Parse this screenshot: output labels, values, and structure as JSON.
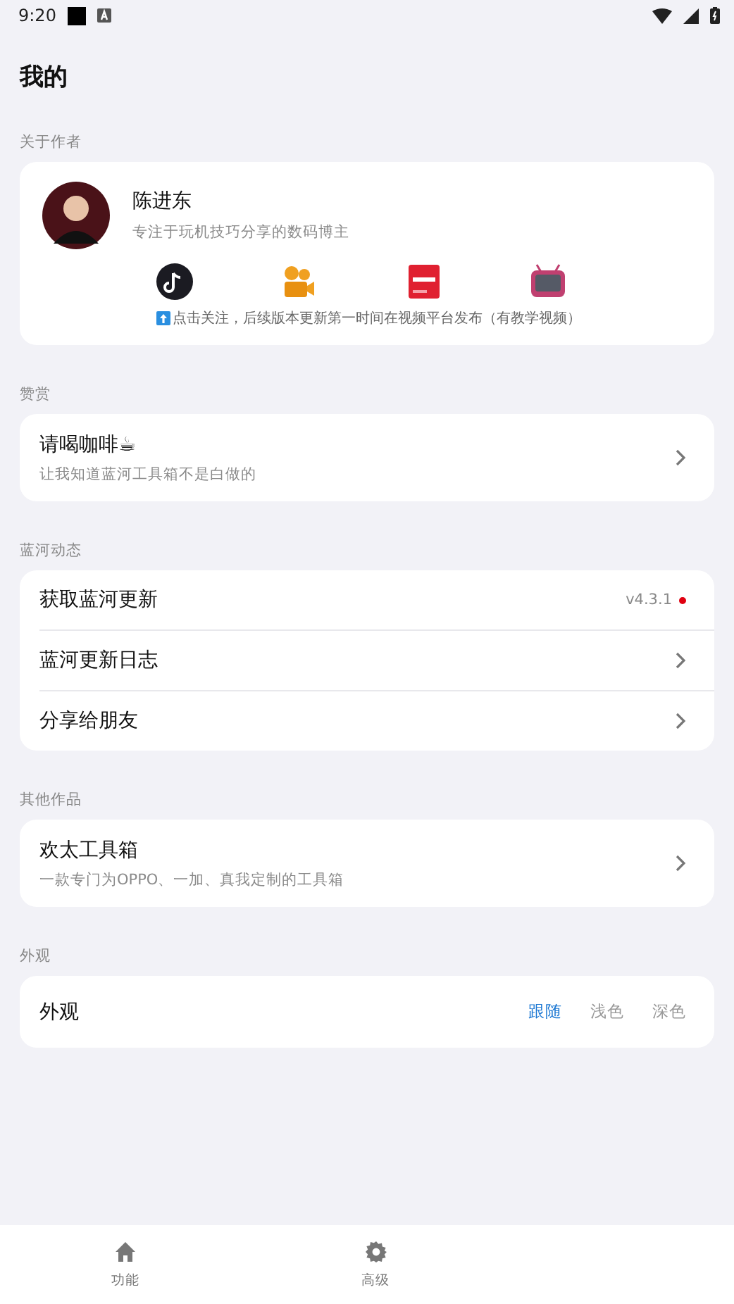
{
  "status_bar": {
    "time": "9:20"
  },
  "title": "我的",
  "author_section": {
    "header": "关于作者",
    "name": "陈进东",
    "bio": "专注于玩机技巧分享的数码博主",
    "platforms": [
      {
        "kind": "note"
      },
      {
        "kind": "camera"
      },
      {
        "kind": "book"
      },
      {
        "kind": "tv"
      }
    ],
    "hint": "点击关注，后续版本更新第一时间在视频平台发布（有教学视频）"
  },
  "sections": [
    {
      "header": "赞赏",
      "rows": [
        {
          "kind": "link",
          "title": "请喝咖啡☕",
          "subtitle": "让我知道蓝河工具箱不是白做的"
        }
      ]
    },
    {
      "header": "蓝河动态",
      "rows": [
        {
          "kind": "version",
          "title": "获取蓝河更新",
          "value": "v4.3.1",
          "has_update": true
        },
        {
          "kind": "link",
          "title": "蓝河更新日志"
        },
        {
          "kind": "link",
          "title": "分享给朋友"
        }
      ]
    },
    {
      "header": "其他作品",
      "rows": [
        {
          "kind": "link",
          "title": "欢太工具箱",
          "subtitle": "一款专门为OPPO、一加、真我定制的工具箱"
        }
      ]
    },
    {
      "header": "外观",
      "rows": [
        {
          "kind": "segmented",
          "title": "外观",
          "options": [
            {
              "label": "跟随",
              "selected": true
            },
            {
              "label": "浅色",
              "selected": false
            },
            {
              "label": "深色",
              "selected": false
            }
          ]
        }
      ]
    }
  ],
  "bottom_nav": [
    {
      "kind": "home",
      "label": "功能",
      "selected": false
    },
    {
      "kind": "settings",
      "label": "高级",
      "selected": false
    }
  ]
}
